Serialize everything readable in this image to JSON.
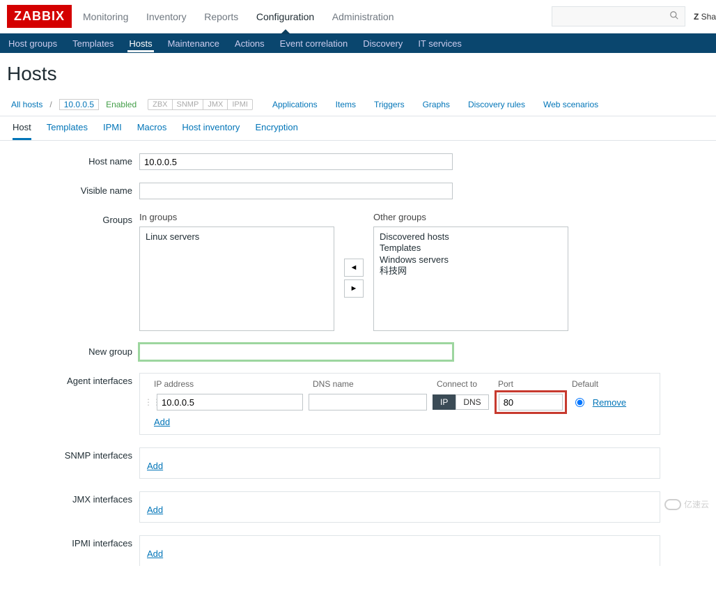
{
  "logo": "ZABBIX",
  "mainNav": {
    "monitoring": "Monitoring",
    "inventory": "Inventory",
    "reports": "Reports",
    "configuration": "Configuration",
    "administration": "Administration"
  },
  "headerRight": {
    "search_placeholder": "",
    "share_prefix": "Z",
    "share_label": "Sha"
  },
  "subNav": {
    "hostgroups": "Host groups",
    "templates": "Templates",
    "hosts": "Hosts",
    "maintenance": "Maintenance",
    "actions": "Actions",
    "eventcorr": "Event correlation",
    "discovery": "Discovery",
    "itservices": "IT services"
  },
  "pageTitle": "Hosts",
  "filter": {
    "allhosts": "All hosts",
    "sep": "/",
    "current": "10.0.0.5",
    "status": "Enabled",
    "avail": {
      "zbx": "ZBX",
      "snmp": "SNMP",
      "jmx": "JMX",
      "ipmi": "IPMI"
    },
    "links": {
      "applications": "Applications",
      "items": "Items",
      "triggers": "Triggers",
      "graphs": "Graphs",
      "discovery": "Discovery rules",
      "web": "Web scenarios"
    }
  },
  "tabs": {
    "host": "Host",
    "templates": "Templates",
    "ipmi": "IPMI",
    "macros": "Macros",
    "hostinv": "Host inventory",
    "encryption": "Encryption"
  },
  "form": {
    "labels": {
      "hostname": "Host name",
      "visiblename": "Visible name",
      "groups": "Groups",
      "ingroups": "In groups",
      "othergroups": "Other groups",
      "newgroup": "New group",
      "agentif": "Agent interfaces",
      "snmpif": "SNMP interfaces",
      "jmxif": "JMX interfaces",
      "ipmiif": "IPMI interfaces"
    },
    "values": {
      "hostname": "10.0.0.5",
      "visiblename": "",
      "newgroup": ""
    },
    "ingroups": [
      "Linux servers"
    ],
    "othergroups": [
      "Discovered hosts",
      "Templates",
      "Windows servers",
      "科技网"
    ],
    "iface": {
      "head": {
        "ip": "IP address",
        "dns": "DNS name",
        "connect": "Connect to",
        "port": "Port",
        "default": "Default"
      },
      "row": {
        "ip": "10.0.0.5",
        "dns": "",
        "conn_ip": "IP",
        "conn_dns": "DNS",
        "port": "80",
        "remove": "Remove"
      },
      "add": "Add"
    }
  },
  "moveBtns": {
    "left": "◄",
    "right": "►"
  },
  "watermark": "亿速云"
}
